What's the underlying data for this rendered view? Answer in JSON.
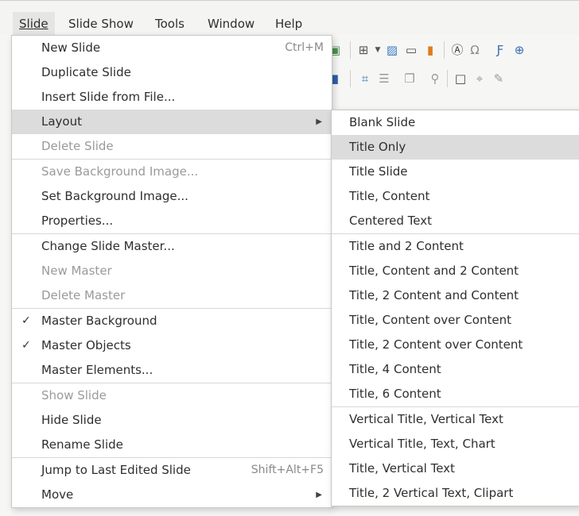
{
  "menubar": {
    "items": [
      {
        "label": "Slide",
        "active": true
      },
      {
        "label": "Slide Show",
        "active": false
      },
      {
        "label": "Tools",
        "active": false
      },
      {
        "label": "Window",
        "active": false
      },
      {
        "label": "Help",
        "active": false
      }
    ]
  },
  "slide_menu": {
    "new_slide": {
      "label": "New Slide",
      "shortcut": "Ctrl+M"
    },
    "duplicate_slide": "Duplicate Slide",
    "insert_slide_from_file": "Insert Slide from File...",
    "layout": "Layout",
    "delete_slide": "Delete Slide",
    "save_background_image": "Save Background Image...",
    "set_background_image": "Set Background Image...",
    "properties": "Properties...",
    "change_slide_master": "Change Slide Master...",
    "new_master": "New Master",
    "delete_master": "Delete Master",
    "master_background": "Master Background",
    "master_objects": "Master Objects",
    "master_elements": "Master Elements...",
    "show_slide": "Show Slide",
    "hide_slide": "Hide Slide",
    "rename_slide": "Rename Slide",
    "jump_to_last_edited": {
      "label": "Jump to Last Edited Slide",
      "shortcut": "Shift+Alt+F5"
    },
    "move": "Move",
    "check_glyph": "✓",
    "arrow_glyph": "▶"
  },
  "layout_submenu": {
    "items": [
      "Blank Slide",
      "Title Only",
      "Title Slide",
      "Title, Content",
      "Centered Text",
      "Title and 2 Content",
      "Title, Content and 2 Content",
      "Title, 2 Content and Content",
      "Title, Content over Content",
      "Title, 2 Content over Content",
      "Title, 4 Content",
      "Title, 6 Content",
      "Vertical Title, Vertical Text",
      "Vertical Title, Text, Chart",
      "Title, Vertical Text",
      "Title, 2 Vertical Text, Clipart"
    ],
    "highlighted": "Title Only"
  },
  "colors": {
    "highlight": "#dcdcdc",
    "disabled_text": "#9a9a9a",
    "menu_bg": "#ffffff"
  }
}
